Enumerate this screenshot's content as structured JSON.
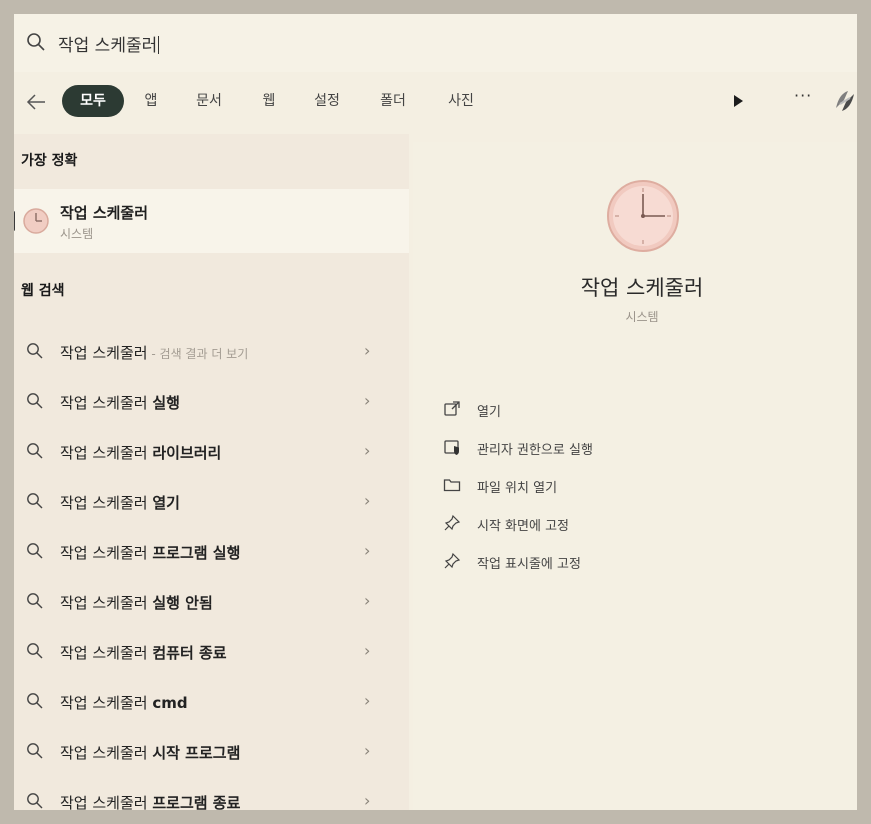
{
  "search": {
    "query": "작업 스케줄러"
  },
  "filters": {
    "tabs": [
      "모두",
      "앱",
      "문서",
      "웹",
      "설정",
      "폴더",
      "사진"
    ],
    "active": "모두",
    "more_label": "···"
  },
  "best_match": {
    "heading": "가장 정확",
    "title": "작업 스케줄러",
    "subtitle": "시스템"
  },
  "web_search": {
    "heading": "웹 검색",
    "items": [
      {
        "base": "작업 스케줄러",
        "bold": "",
        "suffix": " - 검색 결과 더 보기"
      },
      {
        "base": "작업 스케줄러 ",
        "bold": "실행",
        "suffix": ""
      },
      {
        "base": "작업 스케줄러 ",
        "bold": "라이브러리",
        "suffix": ""
      },
      {
        "base": "작업 스케줄러 ",
        "bold": "열기",
        "suffix": ""
      },
      {
        "base": "작업 스케줄러 ",
        "bold": "프로그램 실행",
        "suffix": ""
      },
      {
        "base": "작업 스케줄러 ",
        "bold": "실행 안됨",
        "suffix": ""
      },
      {
        "base": "작업 스케줄러 ",
        "bold": "컴퓨터 종료",
        "suffix": ""
      },
      {
        "base": "작업 스케줄러 ",
        "bold": "cmd",
        "suffix": ""
      },
      {
        "base": "작업 스케줄러 ",
        "bold": "시작 프로그램",
        "suffix": ""
      },
      {
        "base": "작업 스케줄러 ",
        "bold": "프로그램 종료",
        "suffix": ""
      }
    ]
  },
  "detail": {
    "title": "작업 스케줄러",
    "subtitle": "시스템",
    "actions": [
      {
        "label": "열기",
        "icon": "open-external-icon"
      },
      {
        "label": "관리자 권한으로 실행",
        "icon": "shield-icon"
      },
      {
        "label": "파일 위치 열기",
        "icon": "folder-icon"
      },
      {
        "label": "시작 화면에 고정",
        "icon": "pin-icon"
      },
      {
        "label": "작업 표시줄에 고정",
        "icon": "pin-icon"
      }
    ]
  },
  "colors": {
    "accent_chip": "#2c3a33",
    "clock_face": "#f1c9c0"
  }
}
